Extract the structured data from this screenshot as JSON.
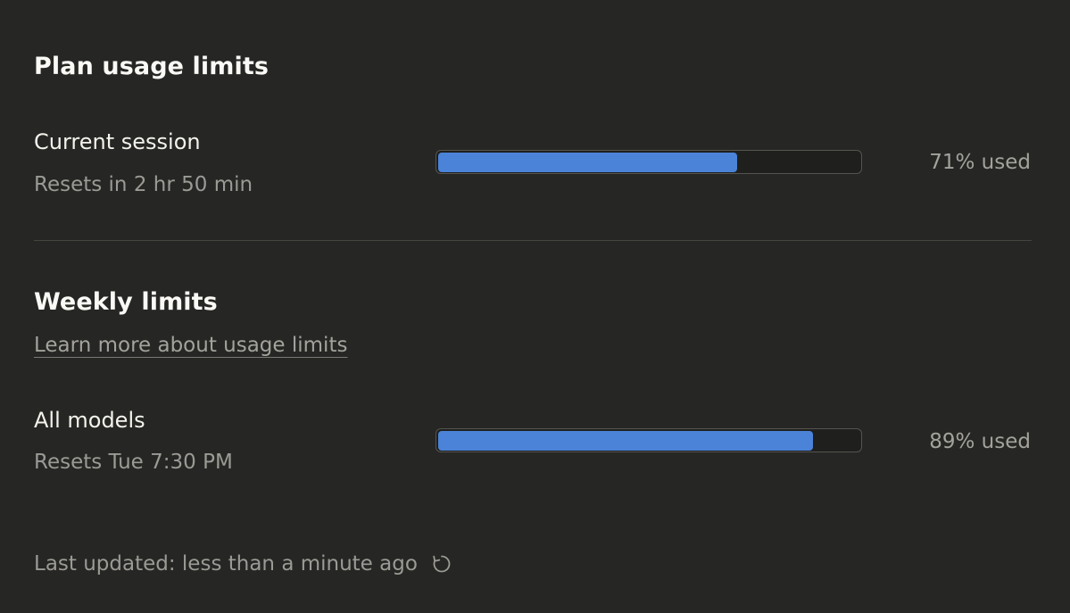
{
  "plan": {
    "title": "Plan usage limits",
    "session": {
      "label": "Current session",
      "reset_text": "Resets in 2 hr 50 min",
      "percent_used": 71,
      "percent_label": "71% used"
    }
  },
  "weekly": {
    "title": "Weekly limits",
    "learn_more_link": "Learn more about usage limits",
    "all_models": {
      "label": "All models",
      "reset_text": "Resets Tue 7:30 PM",
      "percent_used": 89,
      "percent_label": "89% used"
    }
  },
  "footer": {
    "last_updated": "Last updated: less than a minute ago",
    "refresh_icon": "refresh-icon"
  },
  "colors": {
    "background": "#262624",
    "bar_fill": "#4a83d8",
    "bar_track": "#1f1f1d",
    "muted_text": "#9b9a95"
  }
}
